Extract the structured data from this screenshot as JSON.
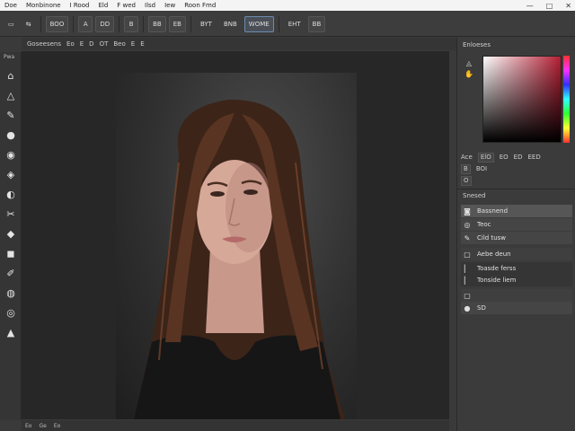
{
  "menubar": {
    "items": [
      "Doe",
      "Monbinone",
      "I Rood",
      "Eld",
      "F wed",
      "Ilsd",
      "Iew",
      "Roon Fmd"
    ],
    "window_controls": [
      "—",
      "□",
      "✕"
    ]
  },
  "options": {
    "buttons": [
      "BOO",
      "A",
      "DD",
      "B",
      "BB",
      "EB",
      "BYT",
      "BNB",
      "WOME",
      "EHT",
      "BB"
    ]
  },
  "doc_tab": [
    "Goseesens",
    "Eo",
    "E",
    "D",
    "OT",
    "Beo",
    "E",
    "E"
  ],
  "tools": {
    "title": "Pwa",
    "icons": [
      "⌂",
      "△",
      "✎",
      "●",
      "◉",
      "◈",
      "◐",
      "✂",
      "◆",
      "◼",
      "✐",
      "◍",
      "◎",
      "▲"
    ]
  },
  "status": [
    "Eo",
    "Ge",
    "Eo"
  ],
  "color_panel": {
    "title": "Enloeses",
    "primary": "#b41f34",
    "row1": [
      "Ace",
      "ElO",
      "EO",
      "ED",
      "EED"
    ],
    "row2": [
      "B",
      "BOI"
    ],
    "row3": [
      "O"
    ]
  },
  "layers_panel": {
    "title": "Snesed",
    "items": [
      {
        "icon": "◙",
        "label": "Bassnend"
      },
      {
        "icon": "◎",
        "label": "Teoc"
      },
      {
        "icon": "✎",
        "label": "Cild tusw"
      },
      {
        "icon": "▢",
        "label": "Aebe deun"
      },
      {
        "icon": "▏",
        "label": "Toasde ferss"
      },
      {
        "icon": "▏",
        "label": "Tonside liem"
      },
      {
        "icon": "▢",
        "label": ""
      },
      {
        "icon": "●",
        "label": "SD"
      }
    ]
  }
}
